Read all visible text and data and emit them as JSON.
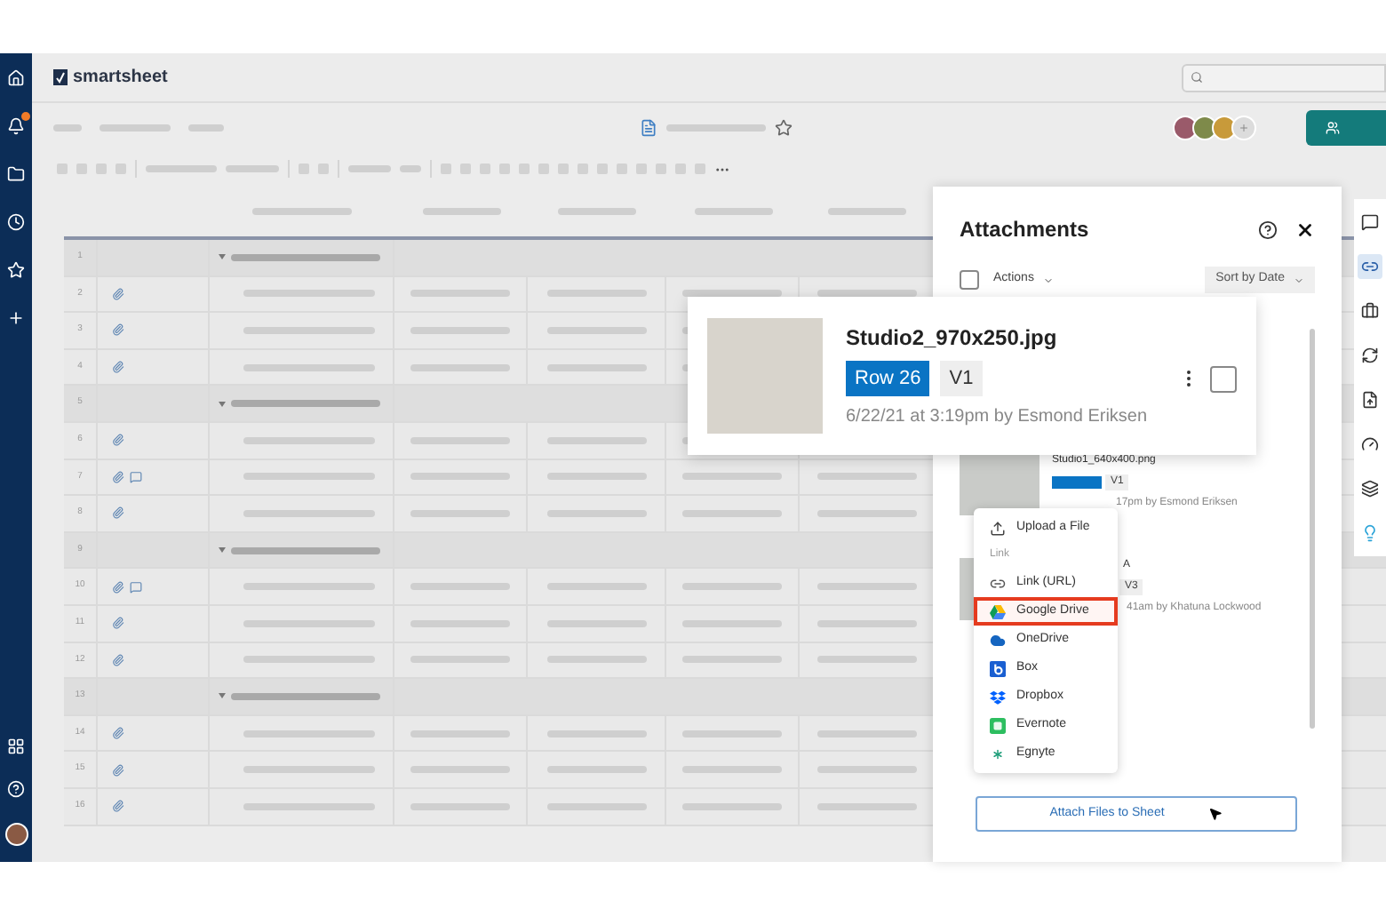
{
  "app": {
    "logo": "smartsheet"
  },
  "left_nav": {
    "notifications_badge": true
  },
  "sheet": {
    "rows": [
      {
        "number": "1",
        "kind": "group",
        "attachment": false,
        "comment": false
      },
      {
        "number": "2",
        "kind": "row",
        "attachment": true,
        "comment": false
      },
      {
        "number": "3",
        "kind": "row",
        "attachment": true,
        "comment": false
      },
      {
        "number": "4",
        "kind": "row",
        "attachment": true,
        "comment": false
      },
      {
        "number": "5",
        "kind": "group",
        "attachment": false,
        "comment": false
      },
      {
        "number": "6",
        "kind": "row",
        "attachment": true,
        "comment": false
      },
      {
        "number": "7",
        "kind": "row",
        "attachment": true,
        "comment": true
      },
      {
        "number": "8",
        "kind": "row",
        "attachment": true,
        "comment": false
      },
      {
        "number": "9",
        "kind": "group",
        "attachment": false,
        "comment": false
      },
      {
        "number": "10",
        "kind": "row",
        "attachment": true,
        "comment": true
      },
      {
        "number": "11",
        "kind": "row",
        "attachment": true,
        "comment": false
      },
      {
        "number": "12",
        "kind": "row",
        "attachment": true,
        "comment": false
      },
      {
        "number": "13",
        "kind": "group",
        "attachment": false,
        "comment": false
      },
      {
        "number": "14",
        "kind": "row",
        "attachment": true,
        "comment": false
      },
      {
        "number": "15",
        "kind": "row",
        "attachment": true,
        "comment": false
      },
      {
        "number": "16",
        "kind": "row",
        "attachment": true,
        "comment": false
      }
    ]
  },
  "attachments_panel": {
    "title": "Attachments",
    "actions": "Actions",
    "sort": "Sort by Date",
    "select_all_checked": false,
    "items": [
      {
        "name": "Studio1_640x400.png",
        "version": "V1",
        "meta": "17pm by Esmond Eriksen"
      },
      {
        "name": "A",
        "version": "V3",
        "meta": "41am by Khatuna Lockwood"
      }
    ],
    "attach_button": "Attach Files to Sheet"
  },
  "preview_card": {
    "file_name": "Studio2_970x250.jpg",
    "row_tag": "Row 26",
    "version": "V1",
    "meta": "6/22/21 at 3:19pm by Esmond Eriksen",
    "checked": false
  },
  "attach_menu": {
    "items": [
      {
        "kind": "action",
        "label": "Upload a File",
        "selected": false
      },
      {
        "kind": "section",
        "label": "Link"
      },
      {
        "kind": "service",
        "label": "Link (URL)",
        "selected": false
      },
      {
        "kind": "service",
        "label": "Google Drive",
        "selected": true
      },
      {
        "kind": "service",
        "label": "OneDrive",
        "selected": false
      },
      {
        "kind": "service",
        "label": "Box",
        "selected": false
      },
      {
        "kind": "service",
        "label": "Dropbox",
        "selected": false
      },
      {
        "kind": "service",
        "label": "Evernote",
        "selected": false
      },
      {
        "kind": "service",
        "label": "Egnyte",
        "selected": false
      }
    ]
  },
  "right_rail": {
    "items": [
      {
        "selected": false
      },
      {
        "selected": true
      },
      {
        "selected": false
      },
      {
        "selected": false
      },
      {
        "selected": false
      },
      {
        "selected": false
      },
      {
        "selected": false
      },
      {
        "selected": false
      }
    ]
  }
}
